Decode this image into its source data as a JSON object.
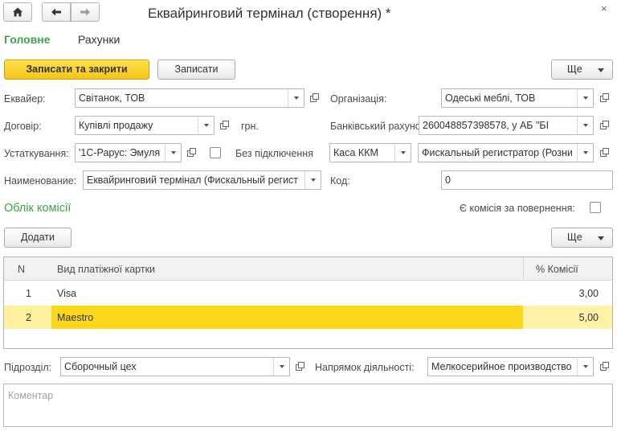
{
  "window": {
    "title": "Еквайринговий термінал (створення) *",
    "close_glyph": "×"
  },
  "nav": {
    "home_icon": "home-icon",
    "back_icon": "arrow-left-icon",
    "forward_icon": "arrow-right-icon"
  },
  "tabs": [
    {
      "label": "Головне",
      "active": true
    },
    {
      "label": "Рахунки",
      "active": false
    }
  ],
  "toolbar": {
    "save_close_label": "Записати та закрити",
    "save_label": "Записати",
    "more_label": "Ще"
  },
  "form": {
    "acquirer": {
      "label": "Еквайер:",
      "value": "Світанок, ТОВ"
    },
    "organization": {
      "label": "Організація:",
      "value": "Одеські меблі, ТОВ"
    },
    "contract": {
      "label": "Договір:",
      "value": "Купівлі продажу",
      "currency": "грн."
    },
    "bank_account": {
      "label": "Банківський рахунок:",
      "value": "260048857398578, у АБ \"БІ"
    },
    "equipment": {
      "label": "Устаткування:",
      "value": "'1С-Рарус: Эмуля"
    },
    "no_connection": {
      "label": "Без підключення",
      "checked": false
    },
    "cash_register": {
      "value": "Каса ККМ"
    },
    "fiscal_register": {
      "value": "Фискальный регистратор (Розни"
    },
    "name": {
      "label": "Наименование:",
      "value": "Еквайринговий термінал (Фискальный регист"
    },
    "code": {
      "label": "Код:",
      "value": "0"
    }
  },
  "commission": {
    "section_title": "Облік комісії",
    "refund_checkbox_label": "Є комісія за повернення:",
    "refund_checked": false,
    "add_label": "Додати",
    "more_label": "Ще",
    "columns": {
      "n": "N",
      "card_type": "Вид платіжної картки",
      "percent": "% Комісії"
    },
    "rows": [
      {
        "n": "1",
        "card_type": "Visa",
        "percent": "3,00",
        "selected": false
      },
      {
        "n": "2",
        "card_type": "Maestro",
        "percent": "5,00",
        "selected": true
      }
    ]
  },
  "footer": {
    "division": {
      "label": "Підрозділ:",
      "value": "Сборочный цех"
    },
    "activity": {
      "label": "Напрямок діяльності:",
      "value": "Мелкосерийное производство"
    },
    "comment_placeholder": "Коментар"
  },
  "colors": {
    "accent_green": "#3ca54b",
    "primary_button": "#f7c41a",
    "selected_row": "#fbd81c",
    "selected_row_light": "#fff2a6"
  }
}
